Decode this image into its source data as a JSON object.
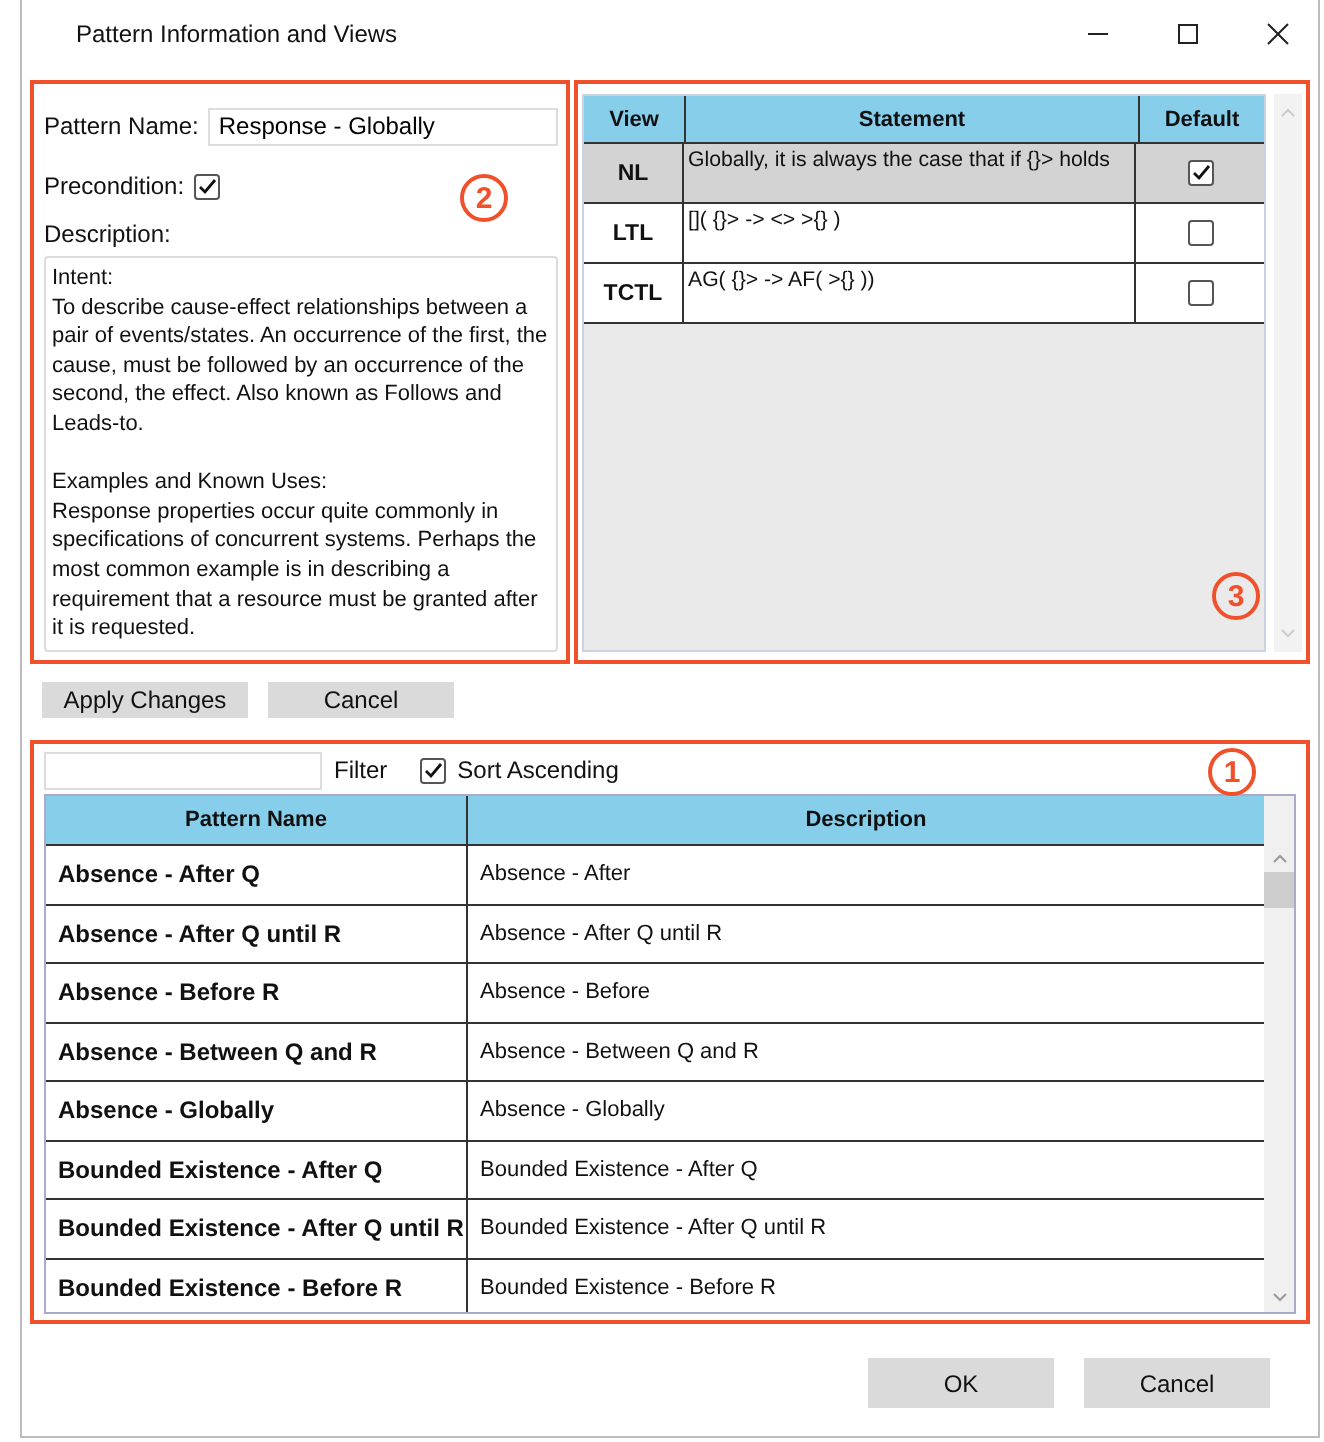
{
  "window": {
    "title": "Pattern Information and Views"
  },
  "details": {
    "name_label": "Pattern Name:",
    "name_value": "Response - Globally",
    "precondition_label": "Precondition:",
    "precondition_checked": true,
    "description_label": "Description:",
    "description": "Intent:\nTo describe cause-effect relationships between a pair of events/states. An occurrence of the first, the cause, must be followed by an occurrence of the second, the effect. Also known as Follows and Leads-to.\n\nExamples and Known Uses:\nResponse properties occur quite commonly in specifications of concurrent systems. Perhaps the most common example is in describing a requirement that a resource must be granted after it is requested.",
    "callout": "2"
  },
  "views": {
    "columns": [
      "View",
      "Statement",
      "Default"
    ],
    "callout": "3",
    "rows": [
      {
        "view": "NL",
        "statement": "Globally, it is always the case that if {}> holds",
        "default": true,
        "selected": true
      },
      {
        "view": "LTL",
        "statement": "[]( {}> -> <> >{} )",
        "default": false,
        "selected": false
      },
      {
        "view": "TCTL",
        "statement": "AG( {}> -> AF( >{} ))",
        "default": false,
        "selected": false
      }
    ]
  },
  "actions": [
    "Apply Changes",
    "Cancel"
  ],
  "patterns": {
    "filter_label": "Filter",
    "sort_label": "Sort Ascending",
    "sort_checked": true,
    "callout": "1",
    "columns": [
      "Pattern Name",
      "Description"
    ],
    "rows": [
      {
        "name": "Absence - After Q",
        "description": "Absence - After"
      },
      {
        "name": "Absence - After Q until R",
        "description": "Absence - After Q until R"
      },
      {
        "name": "Absence - Before R",
        "description": "Absence - Before"
      },
      {
        "name": "Absence - Between Q and R",
        "description": "Absence - Between Q and R"
      },
      {
        "name": "Absence - Globally",
        "description": "Absence - Globally"
      },
      {
        "name": "Bounded Existence - After Q",
        "description": "Bounded Existence - After Q"
      },
      {
        "name": "Bounded Existence - After Q until R",
        "description": "Bounded Existence - After Q until R"
      },
      {
        "name": "Bounded Existence - Before R",
        "description": "Bounded Existence - Before R"
      }
    ]
  },
  "buttons": [
    "OK",
    "Cancel"
  ]
}
